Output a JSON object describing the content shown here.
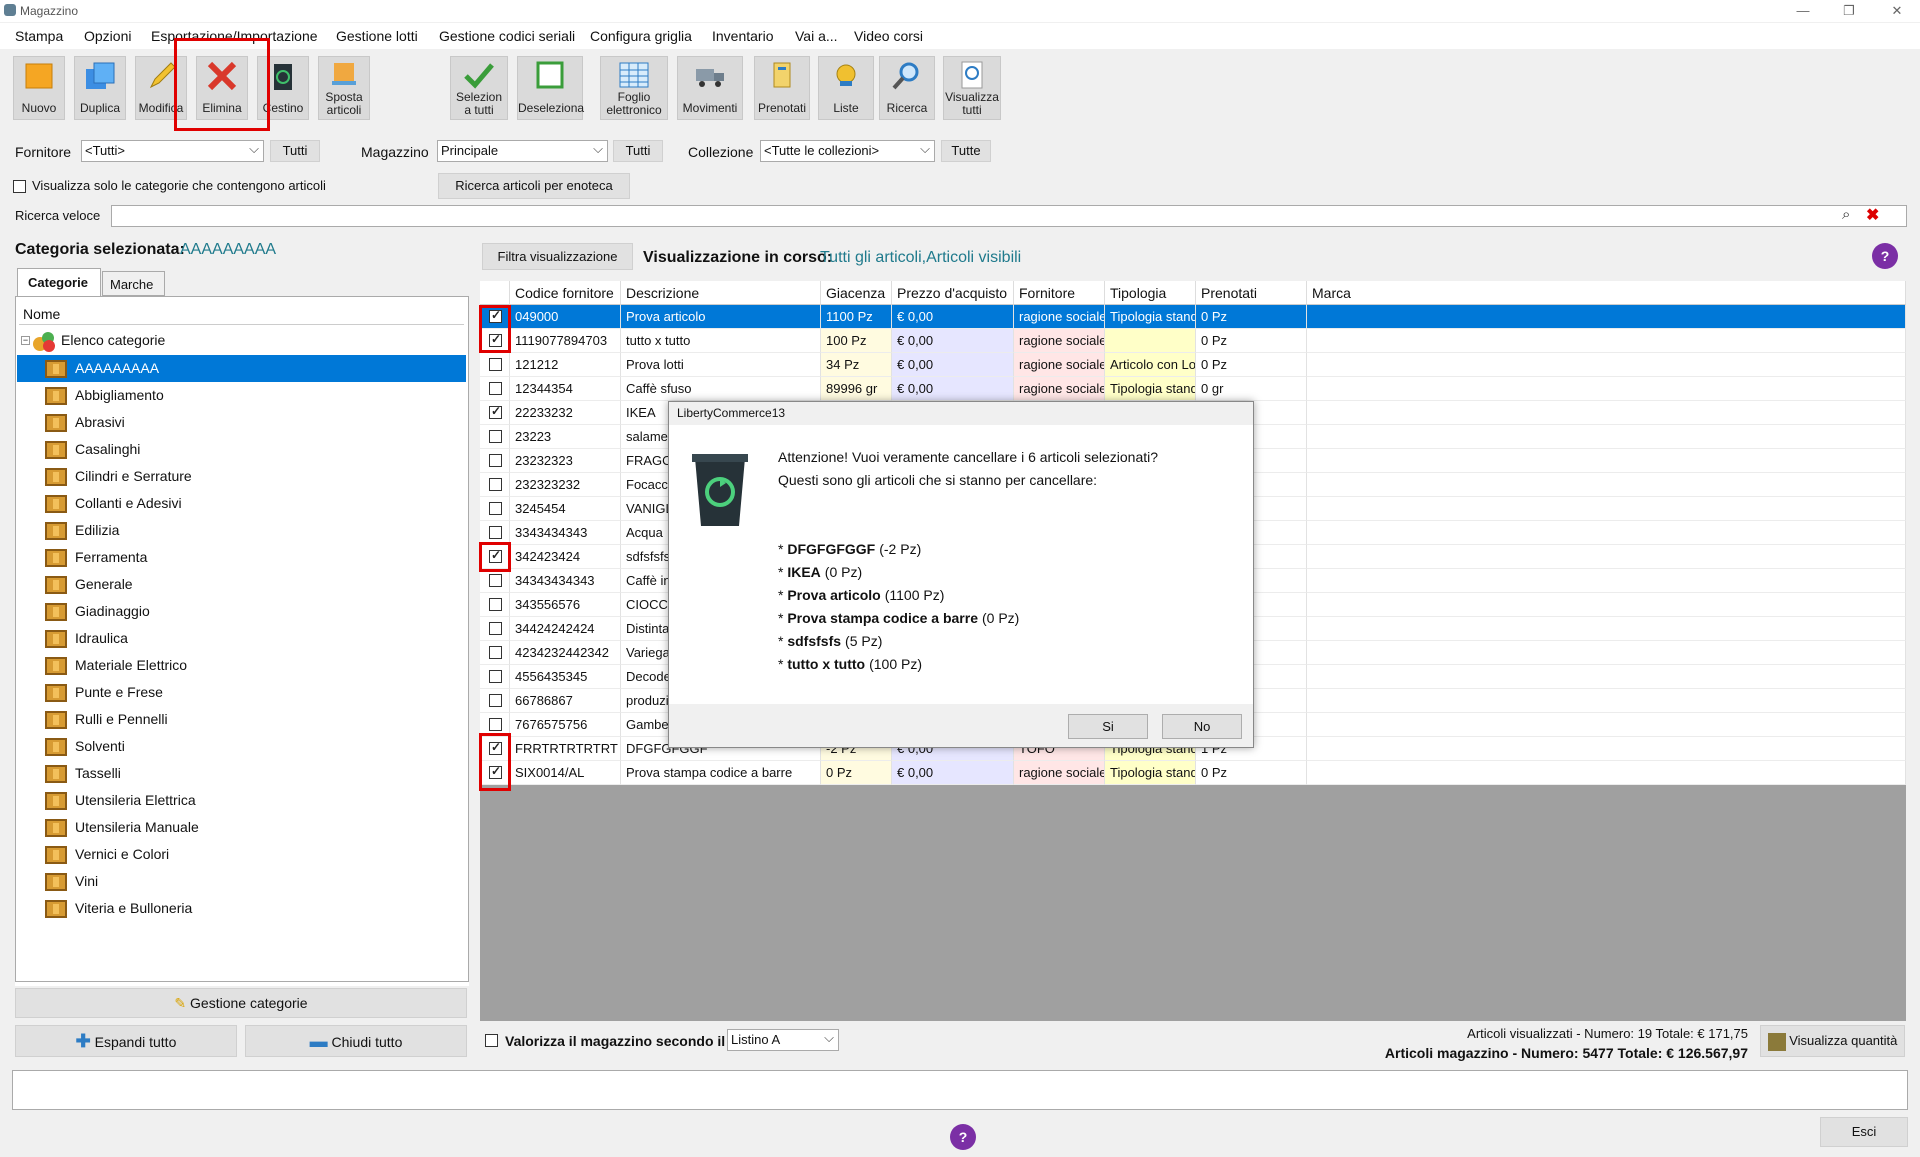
{
  "window": {
    "title": "Magazzino"
  },
  "menu": [
    "Stampa",
    "Opzioni",
    "Esportazione/Importazione",
    "Gestione lotti",
    "Gestione codici seriali",
    "Configura griglia",
    "Inventario",
    "Vai a...",
    "Video corsi"
  ],
  "toolbar": {
    "nuovo": "Nuovo",
    "duplica": "Duplica",
    "modifica": "Modifica",
    "elimina": "Elimina",
    "cestino": "Cestino",
    "sposta1": "Sposta",
    "sposta2": "articoli",
    "selez1": "Selezion",
    "selez2": "a tutti",
    "deseleziona": "Deseleziona",
    "foglio1": "Foglio",
    "foglio2": "elettronico",
    "movimenti": "Movimenti",
    "prenotati": "Prenotati",
    "liste": "Liste",
    "ricerca": "Ricerca",
    "vis1": "Visualizza",
    "vis2": "tutti"
  },
  "filters": {
    "fornitore_label": "Fornitore",
    "fornitore_value": "<Tutti>",
    "fornitore_btn": "Tutti",
    "magazzino_label": "Magazzino",
    "magazzino_value": "Principale",
    "magazzino_btn": "Tutti",
    "collezione_label": "Collezione",
    "collezione_value": "<Tutte le collezioni>",
    "collezione_btn": "Tutte",
    "solo_categorie": "Visualizza solo le categorie che contengono articoli",
    "enoteca_btn": "Ricerca articoli per enoteca",
    "ricerca_label": "Ricerca veloce"
  },
  "left": {
    "cat_label": "Categoria selezionata:",
    "cat_value": "AAAAAAAAA",
    "tab_categorie": "Categorie",
    "tab_marche": "Marche",
    "col_nome": "Nome",
    "root": "Elenco categorie",
    "items": [
      "AAAAAAAAA",
      "Abbigliamento",
      "Abrasivi",
      "Casalinghi",
      "Cilindri e Serrature",
      "Collanti e Adesivi",
      "Edilizia",
      "Ferramenta",
      "Generale",
      "Giadinaggio",
      "Idraulica",
      "Materiale Elettrico",
      "Punte e Frese",
      "Rulli e Pennelli",
      "Solventi",
      "Tasselli",
      "Utensileria Elettrica",
      "Utensileria Manuale",
      "Vernici e Colori",
      "Vini",
      "Viteria e Bulloneria"
    ],
    "gestione_btn": "Gestione categorie",
    "espandi_btn": "Espandi tutto",
    "chiudi_btn": "Chiudi tutto"
  },
  "grid": {
    "filtra_btn": "Filtra visualizzazione",
    "vis_label": "Visualizzazione in corso:",
    "vis_value": "Tutti gli articoli,Articoli visibili",
    "headers": [
      "Codice fornitore",
      "Descrizione",
      "Giacenza",
      "Prezzo d'acquisto",
      "Fornitore",
      "Tipologia",
      "Prenotati",
      "Marca"
    ],
    "rows": [
      {
        "checked": true,
        "sel": true,
        "c": [
          "049000",
          "Prova articolo",
          "1100 Pz",
          "€ 0,00",
          "ragione sociale",
          "Tipologia standard",
          "0 Pz",
          ""
        ]
      },
      {
        "checked": true,
        "c": [
          "1119077894703",
          "tutto x tutto",
          "100 Pz",
          "€ 0,00",
          "ragione sociale",
          "",
          "0 Pz",
          ""
        ]
      },
      {
        "checked": false,
        "c": [
          "121212",
          "Prova lotti",
          "34 Pz",
          "€ 0,00",
          "ragione sociale",
          "Articolo con Lotti",
          "0 Pz",
          ""
        ]
      },
      {
        "checked": false,
        "c": [
          "12344354",
          "Caffè sfuso",
          "89996 gr",
          "€ 0,00",
          "ragione sociale",
          "Tipologia standard",
          "0 gr",
          ""
        ]
      },
      {
        "checked": true,
        "c": [
          "22233232",
          "IKEA",
          "",
          "",
          "",
          "",
          "",
          ""
        ]
      },
      {
        "checked": false,
        "c": [
          "23223",
          "salame",
          "",
          "",
          "",
          "",
          "",
          ""
        ]
      },
      {
        "checked": false,
        "c": [
          "23232323",
          "FRAGOLE",
          "",
          "",
          "",
          "",
          "",
          ""
        ]
      },
      {
        "checked": false,
        "c": [
          "232323232",
          "Focaccia",
          "",
          "",
          "",
          "",
          "",
          ""
        ]
      },
      {
        "checked": false,
        "c": [
          "3245454",
          "VANIGLIA",
          "",
          "",
          "",
          "",
          "",
          ""
        ]
      },
      {
        "checked": false,
        "c": [
          "3343434343",
          "Acqua",
          "",
          "",
          "",
          "",
          "",
          ""
        ]
      },
      {
        "checked": true,
        "c": [
          "342423424",
          "sdfsfsfs",
          "",
          "",
          "",
          "",
          "",
          ""
        ]
      },
      {
        "checked": false,
        "c": [
          "34343434343",
          "Caffè in",
          "",
          "",
          "",
          "",
          "",
          ""
        ]
      },
      {
        "checked": false,
        "c": [
          "343556576",
          "CIOCCOLATO",
          "",
          "",
          "",
          "",
          "",
          ""
        ]
      },
      {
        "checked": false,
        "c": [
          "34424242424",
          "Distinta",
          "",
          "",
          "",
          "",
          "",
          ""
        ]
      },
      {
        "checked": false,
        "c": [
          "4234232442342",
          "Variegato",
          "",
          "",
          "",
          "",
          "",
          ""
        ]
      },
      {
        "checked": false,
        "c": [
          "4556435345",
          "Decoder",
          "",
          "",
          "",
          "",
          "",
          ""
        ]
      },
      {
        "checked": false,
        "c": [
          "66786867",
          "produzione",
          "",
          "",
          "",
          "",
          "",
          ""
        ]
      },
      {
        "checked": false,
        "c": [
          "7676575756",
          "Gamberi",
          "",
          "",
          "",
          "",
          "",
          ""
        ]
      },
      {
        "checked": true,
        "c": [
          "FRRTRTRTRTRT",
          "DFGFGFGGF",
          "-2 Pz",
          "€ 0,00",
          "TOFO",
          "Tipologia standard",
          "1 Pz",
          ""
        ]
      },
      {
        "checked": true,
        "c": [
          "SIX0014/AL",
          "Prova stampa codice a barre",
          "0 Pz",
          "€ 0,00",
          "ragione sociale",
          "Tipologia standard",
          "0 Pz",
          ""
        ]
      }
    ]
  },
  "dialog": {
    "title": "LibertyCommerce13",
    "line1": "Attenzione! Vuoi veramente cancellare i 6 articoli selezionati?",
    "line2": "Questi sono gli articoli che si stanno per cancellare:",
    "items": [
      {
        "name": "DFGFGFGGF",
        "qty": "(-2 Pz)"
      },
      {
        "name": "IKEA",
        "qty": "(0 Pz)"
      },
      {
        "name": "Prova articolo",
        "qty": "(1100 Pz)"
      },
      {
        "name": "Prova stampa codice a barre",
        "qty": "(0 Pz)"
      },
      {
        "name": "sdfsfsfs",
        "qty": "(5 Pz)"
      },
      {
        "name": "tutto x tutto",
        "qty": "(100 Pz)"
      }
    ],
    "si": "Si",
    "no": "No"
  },
  "footer": {
    "valorizza": "Valorizza il magazzino secondo il",
    "listino": "Listino A",
    "art_vis": "Articoli visualizzati - Numero: 19 Totale: € 171,75",
    "art_mag": "Articoli magazzino - Numero: 5477 Totale: € 126.567,97",
    "vis_qta": "Visualizza quantità",
    "esci": "Esci"
  }
}
